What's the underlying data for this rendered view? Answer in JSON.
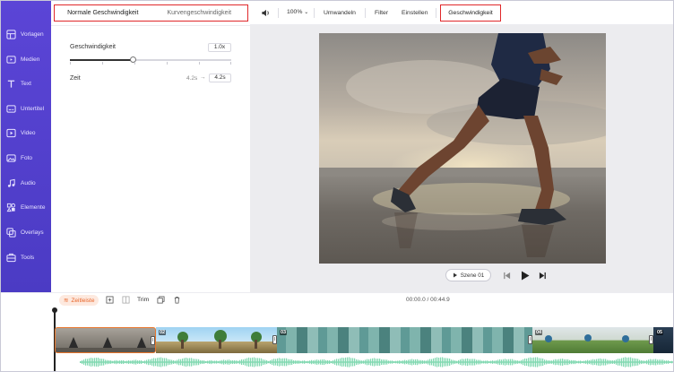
{
  "sidebar": {
    "items": [
      {
        "label": "Vorlagen",
        "icon": "templates-icon"
      },
      {
        "label": "Medien",
        "icon": "media-icon"
      },
      {
        "label": "Text",
        "icon": "text-icon"
      },
      {
        "label": "Untertitel",
        "icon": "subtitles-icon"
      },
      {
        "label": "Video",
        "icon": "video-icon"
      },
      {
        "label": "Foto",
        "icon": "photo-icon"
      },
      {
        "label": "Audio",
        "icon": "audio-icon"
      },
      {
        "label": "Elemente",
        "icon": "elements-icon"
      },
      {
        "label": "Overlays",
        "icon": "overlays-icon"
      },
      {
        "label": "Tools",
        "icon": "tools-icon"
      }
    ]
  },
  "panel": {
    "tabs": [
      "Normale Geschwindigkeit",
      "Kurvengeschwindigkeit"
    ],
    "speed_label": "Geschwindigkeit",
    "speed_value": "1.0x",
    "speed_fraction": 0.39,
    "time_label": "Zeit",
    "time_original": "4.2s",
    "time_arrow": "→",
    "time_new": "4.2s"
  },
  "toolbar": {
    "zoom": "100%",
    "convert": "Umwandeln",
    "filter": "Filter",
    "settings": "Einstellen",
    "speed": "Geschwindigkeit"
  },
  "player": {
    "scene": "Szene 01"
  },
  "timeline": {
    "tab": "Zeitleiste",
    "trim": "Trim",
    "timecode": "00:00.0 / 00:44.9",
    "clips": [
      "",
      "02",
      "03",
      "04",
      "05"
    ]
  },
  "colors": {
    "sidebar": "#5b45d6",
    "highlight": "#e0282b",
    "timeline_accent": "#e8652a",
    "audio_wave": "#7fd8b0"
  }
}
